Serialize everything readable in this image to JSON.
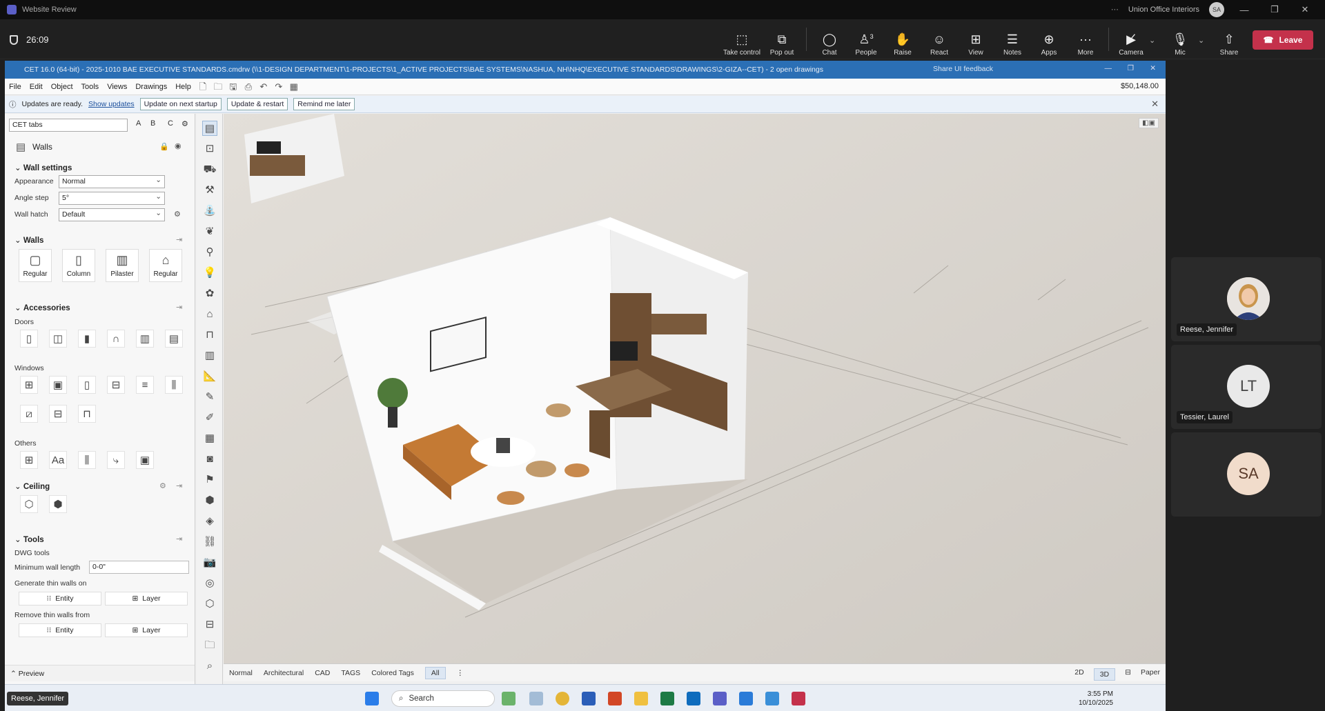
{
  "teams": {
    "window_title": "Website Review",
    "org": "Union Office Interiors",
    "user_initials": "SA",
    "timer": "26:09",
    "toolbar": [
      {
        "label": "Take control",
        "icon": "take-control-icon"
      },
      {
        "label": "Pop out",
        "icon": "pop-out-icon"
      },
      {
        "label": "Chat",
        "icon": "chat-icon"
      },
      {
        "label": "People",
        "icon": "people-icon",
        "count": "3"
      },
      {
        "label": "Raise",
        "icon": "raise-hand-icon"
      },
      {
        "label": "React",
        "icon": "react-icon"
      },
      {
        "label": "View",
        "icon": "view-icon"
      },
      {
        "label": "Notes",
        "icon": "notes-icon"
      },
      {
        "label": "Apps",
        "icon": "apps-icon"
      },
      {
        "label": "More",
        "icon": "more-icon"
      },
      {
        "label": "Camera",
        "icon": "camera-off-icon"
      },
      {
        "label": "Mic",
        "icon": "mic-icon"
      },
      {
        "label": "Share",
        "icon": "share-icon"
      }
    ],
    "leave_label": "Leave",
    "participants": [
      {
        "name": "Reese, Jennifer",
        "initials": ""
      },
      {
        "name": "Tessier, Laurel",
        "initials": "LT"
      },
      {
        "name": "",
        "initials": "SA"
      }
    ],
    "presenter_badge": "Reese, Jennifer"
  },
  "cet": {
    "title": "CET 16.0 (64-bit) - 2025-1010 BAE EXECUTIVE STANDARDS.cmdrw (\\\\1-DESIGN DEPARTMENT\\1-PROJECTS\\1_ACTIVE PROJECTS\\BAE SYSTEMS\\NASHUA, NH\\NHQ\\EXECUTIVE STANDARDS\\DRAWINGS\\2-GIZA--CET) - 2  open drawings",
    "feedback": "Share UI feedback",
    "menu": [
      "File",
      "Edit",
      "Object",
      "Tools",
      "Views",
      "Drawings",
      "Help"
    ],
    "cost": "$50,148.00",
    "update": {
      "message": "Updates are ready.",
      "show_link": "Show updates",
      "btn_next": "Update on next startup",
      "btn_restart": "Update & restart",
      "btn_remind": "Remind me later"
    },
    "panel": {
      "tabs_select": "CET tabs",
      "abc": [
        "A",
        "B",
        "C"
      ],
      "title": "Walls",
      "wall_settings": "Wall settings",
      "appearance_label": "Appearance",
      "appearance_value": "Normal",
      "angle_label": "Angle step",
      "angle_value": "5°",
      "hatch_label": "Wall hatch",
      "hatch_value": "Default",
      "walls_section": "Walls",
      "wall_tools": [
        "Regular",
        "Column",
        "Pilaster",
        "Regular"
      ],
      "accessories": "Accessories",
      "doors": "Doors",
      "windows": "Windows",
      "others": "Others",
      "ceiling": "Ceiling",
      "tools": "Tools",
      "dwg_tools": "DWG tools",
      "min_wall_label": "Minimum wall length",
      "min_wall_value": "0-0\"",
      "gen_thin": "Generate thin walls on",
      "remove_thin": "Remove thin walls from",
      "entity": "Entity",
      "layer": "Layer",
      "preview": "Preview"
    },
    "bottom_tabs": [
      "Normal",
      "Architectural",
      "CAD",
      "TAGS",
      "Colored Tags",
      "All"
    ],
    "active_tab": "All",
    "view_modes": [
      "2D",
      "3D",
      "Paper"
    ]
  },
  "taskbar": {
    "search": "Search",
    "time": "3:55 PM",
    "date": "10/10/2025"
  }
}
